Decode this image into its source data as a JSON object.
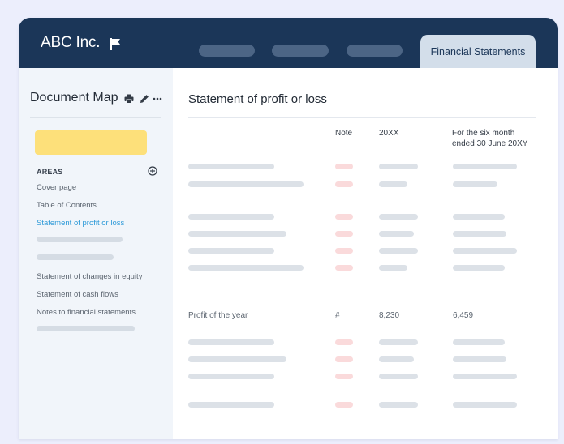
{
  "header": {
    "brand": "ABC Inc.",
    "active_tab": "Financial Statements"
  },
  "sidebar": {
    "title": "Document Map",
    "areas_label": "AREAS",
    "items": [
      {
        "label": "Cover page"
      },
      {
        "label": "Table of Contents"
      },
      {
        "label": "Statement of profit or loss",
        "active": true
      },
      {
        "label": "Statement of changes in equity"
      },
      {
        "label": "Statement of cash flows"
      },
      {
        "label": "Notes to financial statements"
      }
    ]
  },
  "main": {
    "title": "Statement of profit or loss",
    "columns": {
      "note": "Note",
      "current": "20XX",
      "prior_line1": "For the six month",
      "prior_line2": "ended 30 June 20XY"
    },
    "highlight_row": {
      "label": "Profit of the year",
      "note": "#",
      "current": "8,230",
      "prior": "6,459"
    }
  },
  "colors": {
    "header_bg": "#1b3658",
    "active_tab_bg": "#d3deea",
    "search_bar": "#fde07a",
    "active_link": "#2e9ad8",
    "sidebar_bg": "#f1f5fa",
    "note_placeholder": "#fadadb"
  },
  "icons": {
    "flag": "flag-icon",
    "print": "print-icon",
    "edit": "pencil-icon",
    "more": "more-icon",
    "add": "plus-circle-icon"
  }
}
